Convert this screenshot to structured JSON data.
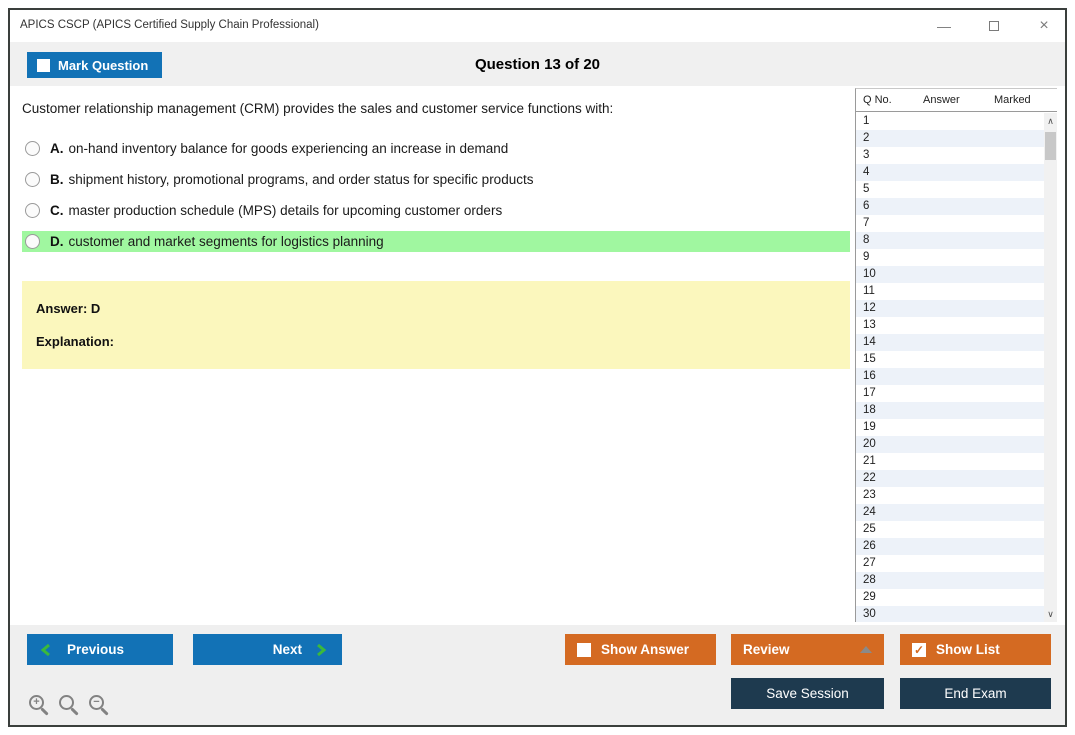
{
  "window": {
    "title": "APICS CSCP (APICS Certified Supply Chain Professional)",
    "controls": {
      "minimize": "—",
      "close": "×"
    }
  },
  "toolbar": {
    "mark_question_label": "Mark Question",
    "question_counter": "Question 13 of 20"
  },
  "question": {
    "text": "Customer relationship management (CRM) provides the sales and customer service functions with:",
    "options": [
      {
        "letter": "A.",
        "text": "on-hand inventory balance for goods experiencing an increase in demand",
        "highlighted": false
      },
      {
        "letter": "B.",
        "text": "shipment history, promotional programs, and order status for specific products",
        "highlighted": false
      },
      {
        "letter": "C.",
        "text": "master production schedule (MPS) details for upcoming customer orders",
        "highlighted": false
      },
      {
        "letter": "D.",
        "text": "customer and market segments for logistics planning",
        "highlighted": true
      }
    ],
    "answer_label": "Answer: D",
    "explanation_label": "Explanation:"
  },
  "question_list": {
    "headers": {
      "qno": "Q No.",
      "answer": "Answer",
      "marked": "Marked"
    },
    "rows": [
      "1",
      "2",
      "3",
      "4",
      "5",
      "6",
      "7",
      "8",
      "9",
      "10",
      "11",
      "12",
      "13",
      "14",
      "15",
      "16",
      "17",
      "18",
      "19",
      "20",
      "21",
      "22",
      "23",
      "24",
      "25",
      "26",
      "27",
      "28",
      "29",
      "30"
    ]
  },
  "footer": {
    "previous_label": "Previous",
    "next_label": "Next",
    "show_answer_label": "Show Answer",
    "review_label": "Review",
    "show_list_label": "Show List",
    "save_session_label": "Save Session",
    "end_exam_label": "End Exam",
    "show_list_checked": "✓"
  },
  "colors": {
    "accent_blue": "#1272b6",
    "accent_orange": "#d46a22",
    "accent_navy": "#1e3a4f",
    "highlight_green": "#a0f7a0",
    "answer_yellow": "#fbf7bd",
    "row_stripe": "#edf2f9",
    "chevron_green": "#3bb93b"
  }
}
